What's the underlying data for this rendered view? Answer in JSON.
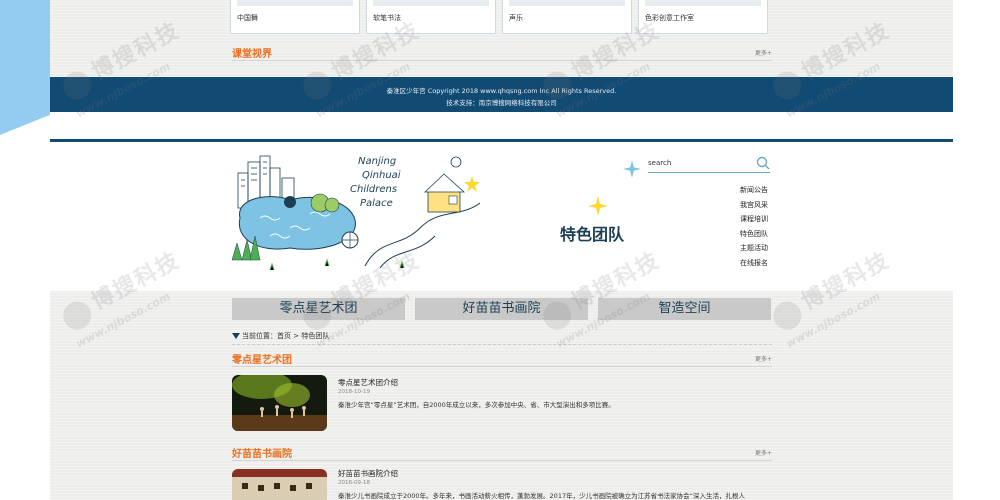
{
  "top": {
    "cards": [
      {
        "label": "中国舞"
      },
      {
        "label": "软笔书法"
      },
      {
        "label": "声乐"
      },
      {
        "label": "色彩创意工作室"
      }
    ],
    "section_title": "课堂视界",
    "more_label": "更多+"
  },
  "footer": {
    "copyright": "秦淮区少年宫 Copyright 2018 www.qhqsng.com Inc All Rights Reserved.",
    "support": "技术支持：南京博搜网络科技有限公司"
  },
  "header": {
    "logo_text": [
      "Nanjing",
      "Qinhuai",
      "Childrens",
      "Palace"
    ],
    "page_heading": "特色团队",
    "search_value": "search",
    "nav_items": [
      "新闻公告",
      "我宫风采",
      "课程培训",
      "特色团队",
      "主题活动",
      "在线报名"
    ]
  },
  "main": {
    "tabs": [
      "零点星艺术团",
      "好苗苗书画院",
      "智造空间"
    ],
    "breadcrumb": "当前位置：首页 > 特色团队",
    "more_label": "更多+",
    "teams": [
      {
        "section_title": "零点星艺术团",
        "title": "零点星艺术团介绍",
        "date": "2018-10-19",
        "desc": "秦淮少年宫“零点星”艺术团，自2000年成立以来，多次参加中央、省、市大型演出和多项比赛。"
      },
      {
        "section_title": "好苗苗书画院",
        "title": "好苗苗书画院介绍",
        "date": "2018-09-18",
        "desc": "秦淮少儿书画院成立于2000年。多年来，书画活动薪火相传，蓬勃发展。2017年，少儿书画院被确立为江苏省书法家协会“深入生活，扎根人"
      }
    ]
  },
  "watermark": {
    "brand": "博搜科技",
    "url": "www.njboso.com"
  },
  "colors": {
    "navy": "#114a73",
    "orange": "#e8701e",
    "sky": "#94ccef"
  }
}
